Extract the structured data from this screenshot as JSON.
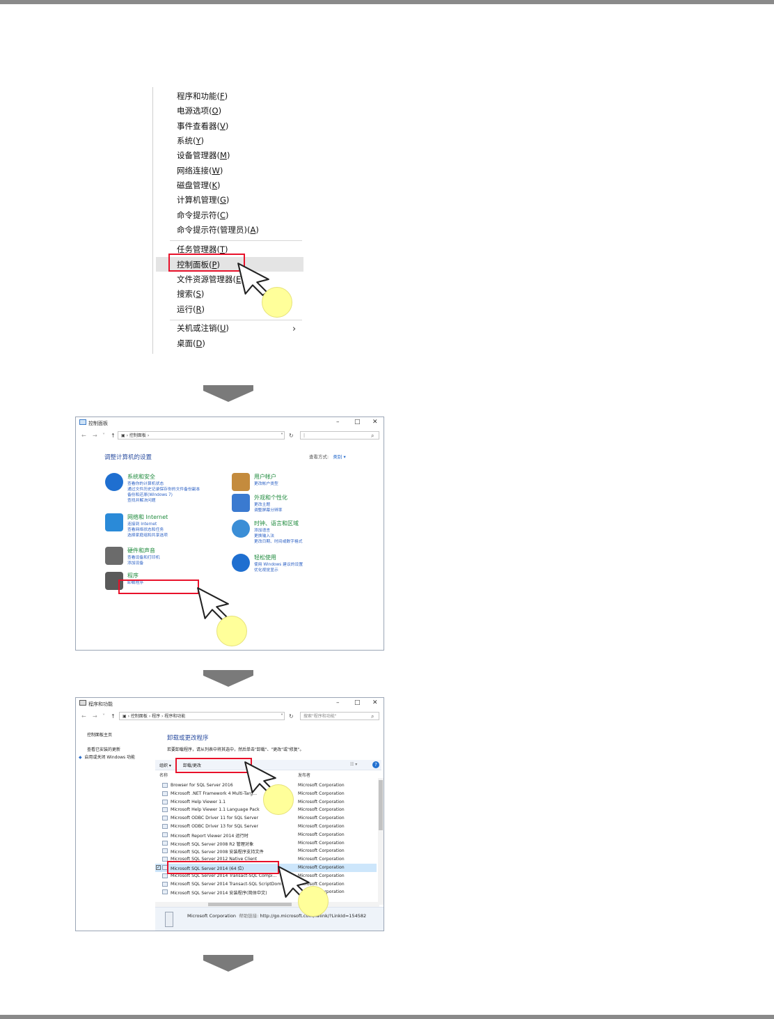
{
  "winx_menu": {
    "items": [
      {
        "label": "程序和功能",
        "key": "F"
      },
      {
        "label": "电源选项",
        "key": "O"
      },
      {
        "label": "事件查看器",
        "key": "V"
      },
      {
        "label": "系统",
        "key": "Y"
      },
      {
        "label": "设备管理器",
        "key": "M"
      },
      {
        "label": "网络连接",
        "key": "W"
      },
      {
        "label": "磁盘管理",
        "key": "K"
      },
      {
        "label": "计算机管理",
        "key": "G"
      },
      {
        "label": "命令提示符",
        "key": "C"
      },
      {
        "label": "命令提示符(管理员)",
        "key": "A"
      },
      {
        "label": "任务管理器",
        "key": "T"
      },
      {
        "label": "控制面板",
        "key": "P"
      },
      {
        "label": "文件资源管理器",
        "key": "E"
      },
      {
        "label": "搜索",
        "key": "S"
      },
      {
        "label": "运行",
        "key": "R"
      },
      {
        "label": "关机或注销",
        "key": "U"
      },
      {
        "label": "桌面",
        "key": "D"
      }
    ]
  },
  "control_panel": {
    "window_title": "控制面板",
    "address": "控制面板",
    "heading": "调整计算机的设置",
    "view_by_label": "查看方式:",
    "view_by_value": "类别 ▾",
    "categories": [
      {
        "title": "系统和安全",
        "links": [
          "查看你的计算机状态",
          "通过文件历史记录保存你的文件备份副本",
          "备份和还原(Windows 7)",
          "查找并解决问题"
        ]
      },
      {
        "title": "网络和 Internet",
        "links": [
          "连接到 Internet",
          "查看网络状态和任务",
          "选择家庭组和共享选项"
        ]
      },
      {
        "title": "硬件和声音",
        "links": [
          "查看设备和打印机",
          "添加设备"
        ]
      },
      {
        "title": "程序",
        "links": [
          "卸载程序"
        ]
      },
      {
        "title": "用户帐户",
        "links": [
          "更改帐户类型"
        ]
      },
      {
        "title": "外观和个性化",
        "links": [
          "更改主题",
          "调整屏幕分辨率"
        ]
      },
      {
        "title": "时钟、语言和区域",
        "links": [
          "添加语言",
          "更换输入法",
          "更改日期、时间或数字格式"
        ]
      },
      {
        "title": "轻松使用",
        "links": [
          "使用 Windows 建议的设置",
          "优化视觉显示"
        ]
      }
    ]
  },
  "programs": {
    "window_title": "程序和功能",
    "breadcrumb": [
      "控制面板",
      "程序",
      "程序和功能"
    ],
    "search_placeholder": "搜索\"程序和功能\"",
    "sidebar": [
      "控制面板主页",
      "查看已安装的更新",
      "启用或关闭 Windows 功能"
    ],
    "heading": "卸载或更改程序",
    "description": "若要卸载程序，请从列表中将其选中，然后单击\"卸载\"、\"更改\"或\"修复\"。",
    "toolbar": {
      "organize": "组织 ▾",
      "uninstall": "卸载/更改"
    },
    "columns": {
      "name": "名称",
      "publisher": "发布者"
    },
    "rows": [
      {
        "name": "Browser for SQL Server 2016",
        "publisher": "Microsoft Corporation"
      },
      {
        "name": "Microsoft .NET Framework 4 Multi-Targ...",
        "publisher": "Microsoft Corporation"
      },
      {
        "name": "Microsoft Help Viewer 1.1",
        "publisher": "Microsoft Corporation"
      },
      {
        "name": "Microsoft Help Viewer 1.1 Language Pack",
        "publisher": "Microsoft Corporation"
      },
      {
        "name": "Microsoft ODBC Driver 11 for SQL Server",
        "publisher": "Microsoft Corporation"
      },
      {
        "name": "Microsoft ODBC Driver 13 for SQL Server",
        "publisher": "Microsoft Corporation"
      },
      {
        "name": "Microsoft Report Viewer 2014 运行时",
        "publisher": "Microsoft Corporation"
      },
      {
        "name": "Microsoft SQL Server 2008 R2 管理对象",
        "publisher": "Microsoft Corporation"
      },
      {
        "name": "Microsoft SQL Server 2008 安装程序支持文件",
        "publisher": "Microsoft Corporation"
      },
      {
        "name": "Microsoft SQL Server 2012 Native Client",
        "publisher": "Microsoft Corporation"
      },
      {
        "name": "Microsoft SQL Server 2014 (64 位)",
        "publisher": "Microsoft Corporation"
      },
      {
        "name": "Microsoft SQL Server 2014 Transact-SQL Compi...",
        "publisher": "Microsoft Corporation"
      },
      {
        "name": "Microsoft SQL Server 2014 Transact-SQL ScriptDom",
        "publisher": "Microsoft Corporation"
      },
      {
        "name": "Microsoft SQL Server 2014 安装程序(简体中文)",
        "publisher": "Microsoft Corporation"
      }
    ],
    "selected_index": 10,
    "details": {
      "publisher": "Microsoft Corporation",
      "help_label": "帮助链接:",
      "help_link": "http://go.microsoft.com/fwlink/?LinkId=154582"
    }
  }
}
